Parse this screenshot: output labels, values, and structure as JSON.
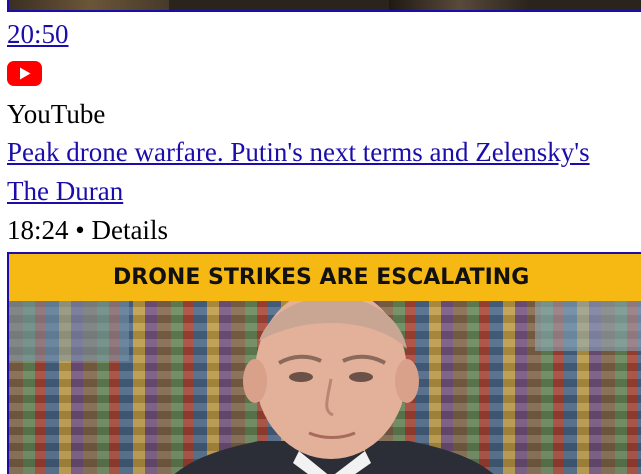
{
  "previous_item": {
    "time_link": "20:50",
    "source_icon": "youtube-logo-icon",
    "source_name": "YouTube"
  },
  "video": {
    "title": "Peak drone warfare. Putin's next terms and Zelensky's",
    "channel": "The Duran",
    "duration": "18:24",
    "separator": "•",
    "details_label": "Details",
    "thumbnail_caption": "DRONE STRIKES ARE ESCALATING"
  },
  "colors": {
    "link": "#1a0dab",
    "youtube_red": "#ff0000",
    "banner_yellow": "#f6b813"
  }
}
